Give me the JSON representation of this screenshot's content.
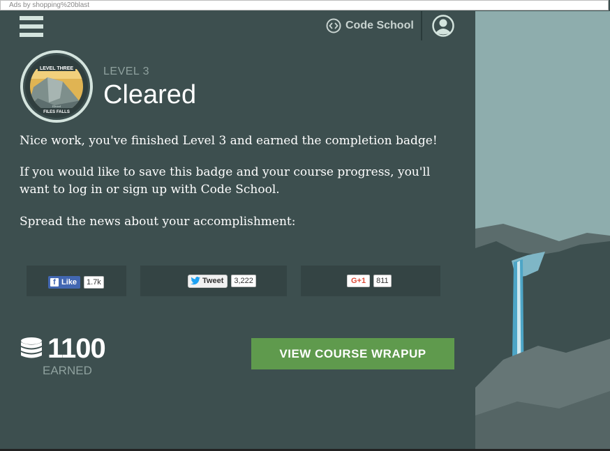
{
  "ad_bar": {
    "text": "Ads by shopping%20blast"
  },
  "header": {
    "brand": "Code School"
  },
  "badge": {
    "top_text": "LEVEL THREE",
    "bottom_text": "FILES FALLS",
    "script_text": "Elected"
  },
  "level": {
    "label": "LEVEL 3",
    "status": "Cleared"
  },
  "body": {
    "message1": "Nice work, you've finished Level 3 and earned the completion badge!",
    "message2": "If you would like to save this badge and your course progress, you'll want to log in or sign up with Code School.",
    "message3": "Spread the news about your accomplishment:"
  },
  "social": {
    "facebook": {
      "label": "Like",
      "count": "1.7k"
    },
    "twitter": {
      "label": "Tweet",
      "count": "3,222"
    },
    "google": {
      "label": "G+1",
      "count": "811"
    }
  },
  "points": {
    "value": "1100",
    "label": "EARNED"
  },
  "cta": {
    "label": "VIEW COURSE WRAPUP"
  },
  "colors": {
    "panel": "#3d4f4f",
    "button": "#5f9a4d",
    "scenery": "#8eadad"
  }
}
